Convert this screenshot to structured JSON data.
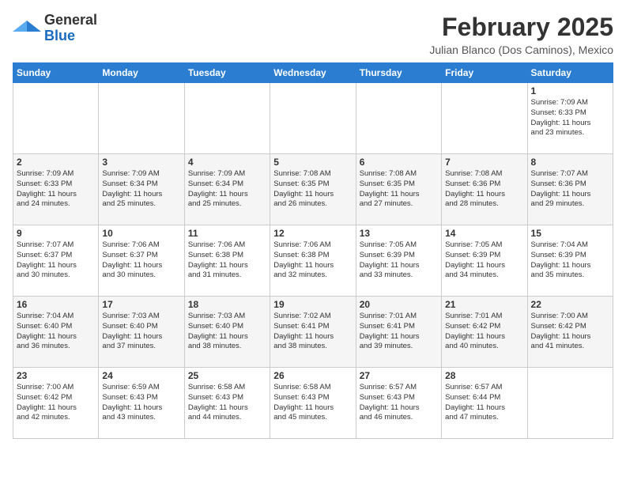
{
  "header": {
    "logo_general": "General",
    "logo_blue": "Blue",
    "month_year": "February 2025",
    "location": "Julian Blanco (Dos Caminos), Mexico"
  },
  "weekdays": [
    "Sunday",
    "Monday",
    "Tuesday",
    "Wednesday",
    "Thursday",
    "Friday",
    "Saturday"
  ],
  "weeks": [
    [
      {
        "day": "",
        "info": ""
      },
      {
        "day": "",
        "info": ""
      },
      {
        "day": "",
        "info": ""
      },
      {
        "day": "",
        "info": ""
      },
      {
        "day": "",
        "info": ""
      },
      {
        "day": "",
        "info": ""
      },
      {
        "day": "1",
        "info": "Sunrise: 7:09 AM\nSunset: 6:33 PM\nDaylight: 11 hours\nand 23 minutes."
      }
    ],
    [
      {
        "day": "2",
        "info": "Sunrise: 7:09 AM\nSunset: 6:33 PM\nDaylight: 11 hours\nand 24 minutes."
      },
      {
        "day": "3",
        "info": "Sunrise: 7:09 AM\nSunset: 6:34 PM\nDaylight: 11 hours\nand 25 minutes."
      },
      {
        "day": "4",
        "info": "Sunrise: 7:09 AM\nSunset: 6:34 PM\nDaylight: 11 hours\nand 25 minutes."
      },
      {
        "day": "5",
        "info": "Sunrise: 7:08 AM\nSunset: 6:35 PM\nDaylight: 11 hours\nand 26 minutes."
      },
      {
        "day": "6",
        "info": "Sunrise: 7:08 AM\nSunset: 6:35 PM\nDaylight: 11 hours\nand 27 minutes."
      },
      {
        "day": "7",
        "info": "Sunrise: 7:08 AM\nSunset: 6:36 PM\nDaylight: 11 hours\nand 28 minutes."
      },
      {
        "day": "8",
        "info": "Sunrise: 7:07 AM\nSunset: 6:36 PM\nDaylight: 11 hours\nand 29 minutes."
      }
    ],
    [
      {
        "day": "9",
        "info": "Sunrise: 7:07 AM\nSunset: 6:37 PM\nDaylight: 11 hours\nand 30 minutes."
      },
      {
        "day": "10",
        "info": "Sunrise: 7:06 AM\nSunset: 6:37 PM\nDaylight: 11 hours\nand 30 minutes."
      },
      {
        "day": "11",
        "info": "Sunrise: 7:06 AM\nSunset: 6:38 PM\nDaylight: 11 hours\nand 31 minutes."
      },
      {
        "day": "12",
        "info": "Sunrise: 7:06 AM\nSunset: 6:38 PM\nDaylight: 11 hours\nand 32 minutes."
      },
      {
        "day": "13",
        "info": "Sunrise: 7:05 AM\nSunset: 6:39 PM\nDaylight: 11 hours\nand 33 minutes."
      },
      {
        "day": "14",
        "info": "Sunrise: 7:05 AM\nSunset: 6:39 PM\nDaylight: 11 hours\nand 34 minutes."
      },
      {
        "day": "15",
        "info": "Sunrise: 7:04 AM\nSunset: 6:39 PM\nDaylight: 11 hours\nand 35 minutes."
      }
    ],
    [
      {
        "day": "16",
        "info": "Sunrise: 7:04 AM\nSunset: 6:40 PM\nDaylight: 11 hours\nand 36 minutes."
      },
      {
        "day": "17",
        "info": "Sunrise: 7:03 AM\nSunset: 6:40 PM\nDaylight: 11 hours\nand 37 minutes."
      },
      {
        "day": "18",
        "info": "Sunrise: 7:03 AM\nSunset: 6:40 PM\nDaylight: 11 hours\nand 38 minutes."
      },
      {
        "day": "19",
        "info": "Sunrise: 7:02 AM\nSunset: 6:41 PM\nDaylight: 11 hours\nand 38 minutes."
      },
      {
        "day": "20",
        "info": "Sunrise: 7:01 AM\nSunset: 6:41 PM\nDaylight: 11 hours\nand 39 minutes."
      },
      {
        "day": "21",
        "info": "Sunrise: 7:01 AM\nSunset: 6:42 PM\nDaylight: 11 hours\nand 40 minutes."
      },
      {
        "day": "22",
        "info": "Sunrise: 7:00 AM\nSunset: 6:42 PM\nDaylight: 11 hours\nand 41 minutes."
      }
    ],
    [
      {
        "day": "23",
        "info": "Sunrise: 7:00 AM\nSunset: 6:42 PM\nDaylight: 11 hours\nand 42 minutes."
      },
      {
        "day": "24",
        "info": "Sunrise: 6:59 AM\nSunset: 6:43 PM\nDaylight: 11 hours\nand 43 minutes."
      },
      {
        "day": "25",
        "info": "Sunrise: 6:58 AM\nSunset: 6:43 PM\nDaylight: 11 hours\nand 44 minutes."
      },
      {
        "day": "26",
        "info": "Sunrise: 6:58 AM\nSunset: 6:43 PM\nDaylight: 11 hours\nand 45 minutes."
      },
      {
        "day": "27",
        "info": "Sunrise: 6:57 AM\nSunset: 6:43 PM\nDaylight: 11 hours\nand 46 minutes."
      },
      {
        "day": "28",
        "info": "Sunrise: 6:57 AM\nSunset: 6:44 PM\nDaylight: 11 hours\nand 47 minutes."
      },
      {
        "day": "",
        "info": ""
      }
    ]
  ]
}
